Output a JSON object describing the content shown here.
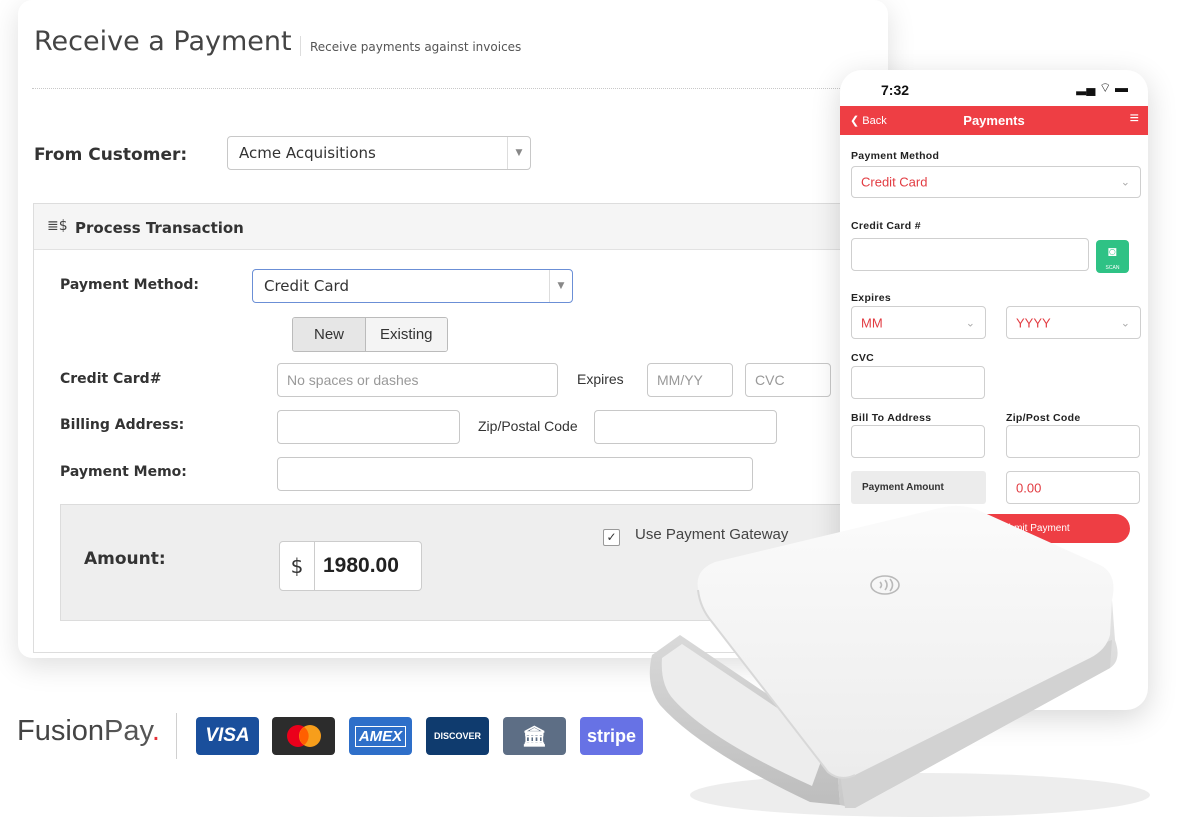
{
  "desktop": {
    "title": "Receive a Payment",
    "subtitle": "Receive payments against invoices",
    "from_customer_label": "From Customer:",
    "customer_value": "Acme Acquisitions",
    "panel_title": "Process Transaction",
    "payment_method_label": "Payment Method:",
    "payment_method_value": "Credit Card",
    "seg_new": "New",
    "seg_existing": "Existing",
    "credit_card_label": "Credit Card#",
    "card_placeholder": "No spaces or dashes",
    "expires_label": "Expires",
    "expires_placeholder": "MM/YY",
    "cvc_placeholder": "CVC",
    "billing_label": "Billing Address:",
    "zip_label": "Zip/Postal Code",
    "memo_label": "Payment Memo:",
    "amount_label": "Amount:",
    "currency": "$",
    "amount_value": "1980.00",
    "gateway_label": "Use Payment Gateway",
    "gateway_checked": true
  },
  "phone": {
    "time": "7:32",
    "back_label": "Back",
    "title": "Payments",
    "payment_method_label": "Payment Method",
    "payment_method_value": "Credit Card",
    "card_label": "Credit Card #",
    "scan_label": "SCAN",
    "expires_label": "Expires",
    "month_value": "MM",
    "year_value": "YYYY",
    "cvc_label": "CVC",
    "bill_label": "Bill To Address",
    "zip_label": "Zip/Post Code",
    "amount_label": "Payment Amount",
    "amount_value": "0.00",
    "submit_label": "Submit Payment"
  },
  "brand": {
    "name_a": "Fusion",
    "name_b": "Pay",
    "methods": [
      "VISA",
      "mastercard",
      "AMEX",
      "DISCOVER",
      "bank",
      "stripe"
    ]
  },
  "colors": {
    "accent_red": "#ee3e44",
    "scan_green": "#2fc285",
    "visa": "#1a4f9c",
    "mastercard": "#2c2c2c",
    "amex": "#2e6fc9",
    "discover": "#0f3b6e",
    "bank": "#5d6e85",
    "stripe": "#6772e5"
  }
}
